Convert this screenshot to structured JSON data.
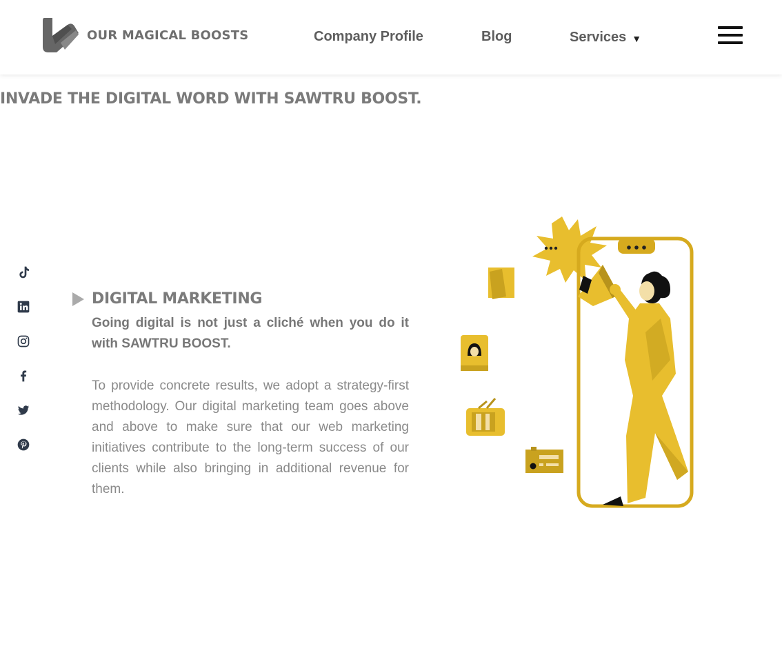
{
  "header": {
    "brand": "OUR MAGICAL BOOSTS",
    "nav": {
      "company_profile": "Company Profile",
      "blog": "Blog",
      "services": "Services"
    },
    "services_caret": "▼",
    "menu_icon": "hamburger-menu-icon"
  },
  "marquee": {
    "text": "INVADE THE DIGITAL WORD WITH SAWTRU BOOST."
  },
  "social": [
    "tiktok-icon",
    "linkedin-icon",
    "instagram-icon",
    "facebook-icon",
    "twitter-icon",
    "pinterest-icon"
  ],
  "section": {
    "title": "DIGITAL MARKETING",
    "lead": "Going digital is not just a cliché when you do it with SAWTRU BOOST.",
    "body": "To provide concrete results, we adopt a strategy-first methodology. Our digital marketing team goes above and above to make sure that our web marketing initiatives contribute to the long-term success of our clients while also bringing in additional revenue for them."
  },
  "colors": {
    "accent_yellow": "#E8BE2E",
    "dark_yellow": "#C9A21F",
    "text_gray": "#7A7A7A"
  }
}
